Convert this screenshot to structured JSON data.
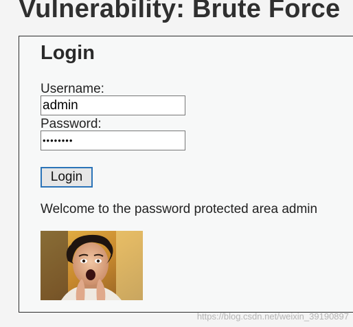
{
  "page": {
    "title": "Vulnerability: Brute Force"
  },
  "login": {
    "heading": "Login",
    "username_label": "Username:",
    "username_value": "admin",
    "password_label": "Password:",
    "password_value": "password",
    "button_label": "Login"
  },
  "result": {
    "welcome_message": "Welcome to the password protected area admin"
  },
  "footer": {
    "watermark": "https://blog.csdn.net/weixin_39190897"
  }
}
